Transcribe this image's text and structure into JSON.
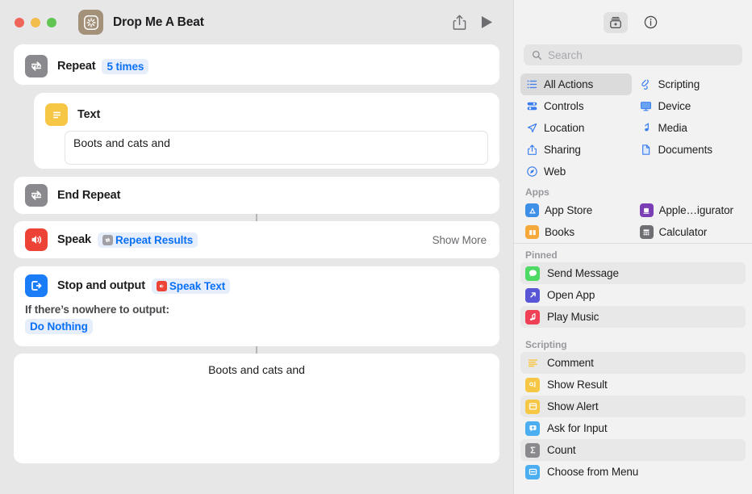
{
  "window": {
    "title": "Drop Me A Beat",
    "app_icon": "shortcuts-sparkle-icon",
    "traffic_lights": [
      "close",
      "minimize",
      "zoom"
    ],
    "share_button_label": "Share",
    "run_button_label": "Run"
  },
  "workflow": {
    "actions": [
      {
        "name": "Repeat",
        "title": "Repeat",
        "icon": "repeat-icon",
        "icon_color": "#8a8a8e",
        "token": "5 times"
      },
      {
        "name": "Text",
        "title": "Text",
        "icon": "text-lines-icon",
        "icon_color": "#f6c744",
        "value": "Boots and cats and"
      },
      {
        "name": "End Repeat",
        "title": "End Repeat",
        "icon": "repeat-icon",
        "icon_color": "#8a8a8e"
      },
      {
        "name": "Speak",
        "title": "Speak",
        "icon": "speaker-wave-icon",
        "icon_color": "#ed4337",
        "token": "Repeat Results",
        "token_icon": "repeat-token-icon",
        "show_more": "Show More"
      },
      {
        "name": "Stop and output",
        "title": "Stop and output",
        "icon": "stop-output-icon",
        "icon_color": "#1a7cf7",
        "token": "Speak Text",
        "token_icon": "speaker-token-icon",
        "sub_label": "If there’s nowhere to output:",
        "sub_token": "Do Nothing"
      }
    ],
    "result": {
      "text": "Boots and cats and"
    }
  },
  "library": {
    "toolbar": {
      "action_library_icon": "action-library-icon",
      "info_icon": "info-circle-icon"
    },
    "search": {
      "placeholder": "Search",
      "value": "",
      "icon": "search-icon"
    },
    "categories": [
      {
        "label": "All Actions",
        "icon": "list-bullet-icon",
        "selected": true
      },
      {
        "label": "Scripting",
        "icon": "scripting-icon",
        "selected": false
      },
      {
        "label": "Controls",
        "icon": "controls-icon",
        "selected": false
      },
      {
        "label": "Device",
        "icon": "display-icon",
        "selected": false
      },
      {
        "label": "Location",
        "icon": "location-arrow-icon",
        "selected": false
      },
      {
        "label": "Media",
        "icon": "music-note-icon",
        "selected": false
      },
      {
        "label": "Sharing",
        "icon": "share-up-icon",
        "selected": false
      },
      {
        "label": "Documents",
        "icon": "document-page-icon",
        "selected": false
      },
      {
        "label": "Web",
        "icon": "safari-compass-icon",
        "selected": false
      }
    ],
    "apps_header": "Apps",
    "apps": [
      {
        "label": "App Store",
        "icon": "app-store-icon",
        "color": "#3e8fe8"
      },
      {
        "label": "Apple…igurator",
        "icon": "apple-configurator-icon",
        "color": "#7b3fb5"
      },
      {
        "label": "Books",
        "icon": "books-icon",
        "color": "#f6a93b"
      },
      {
        "label": "Calculator",
        "icon": "calculator-icon",
        "color": "#6e6e73"
      }
    ],
    "pinned_header": "Pinned",
    "pinned": [
      {
        "label": "Send Message",
        "icon": "messages-icon",
        "color": "#4cd964"
      },
      {
        "label": "Open App",
        "icon": "open-app-icon",
        "color": "#5856d6"
      },
      {
        "label": "Play Music",
        "icon": "music-app-icon",
        "color": "#ef4056"
      }
    ],
    "scripting_header": "Scripting",
    "scripting": [
      {
        "label": "Comment",
        "icon": "comment-lines-icon",
        "color": "#f6c744"
      },
      {
        "label": "Show Result",
        "icon": "show-result-icon",
        "color": "#f6c744"
      },
      {
        "label": "Show Alert",
        "icon": "show-alert-icon",
        "color": "#f6c744"
      },
      {
        "label": "Ask for Input",
        "icon": "ask-input-icon",
        "color": "#4aaef0"
      },
      {
        "label": "Count",
        "icon": "sigma-count-icon",
        "color": "#8a8a8e"
      },
      {
        "label": "Choose from Menu",
        "icon": "choose-menu-icon",
        "color": "#4aaef0"
      }
    ]
  }
}
